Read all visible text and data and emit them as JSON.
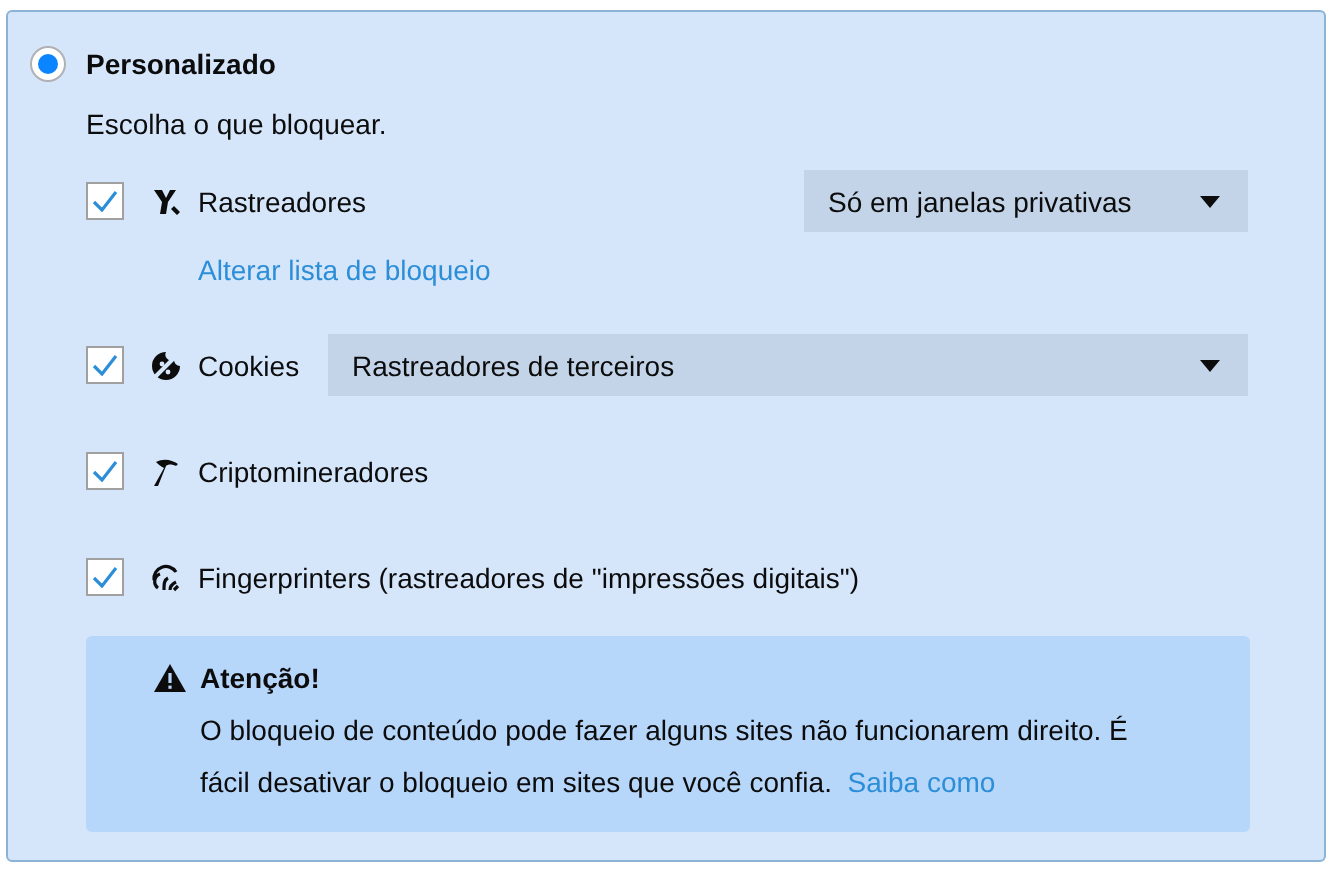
{
  "option": {
    "label": "Personalizado",
    "selected": true
  },
  "intro": "Escolha o que bloquear.",
  "items": [
    {
      "kind": "tracker",
      "label": "Rastreadores",
      "checked": true,
      "select": {
        "kind": "compact",
        "value": "Só em janelas privativas"
      },
      "link": "Alterar lista de bloqueio"
    },
    {
      "kind": "cookie",
      "label": "Cookies",
      "checked": true,
      "select": {
        "kind": "full",
        "value": "Rastreadores de terceiros"
      }
    },
    {
      "kind": "miner",
      "label": "Criptomineradores",
      "checked": true
    },
    {
      "kind": "fingerprint",
      "label": "Fingerprinters (rastreadores de \"impressões digitais\")",
      "checked": true
    }
  ],
  "warning": {
    "title": "Atenção!",
    "text": "O bloqueio de conteúdo pode fazer alguns sites não funcionarem direito. É fácil desativar o bloqueio em sites que você confia.",
    "link": "Saiba como"
  }
}
